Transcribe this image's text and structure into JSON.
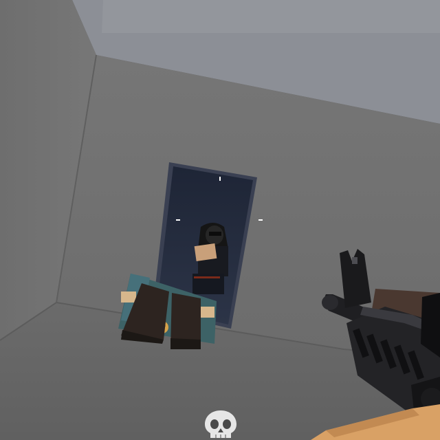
{
  "colors": {
    "wall": "#6f6f6f",
    "wall_dark": "#5b5b5b",
    "ceiling": "#8a8c92",
    "floor": "#6a6a6a",
    "doorway": "#22293a",
    "gun_dark": "#1d1d1f",
    "gun_tan": "#d9a165",
    "crosshair": "#ffffff"
  },
  "icons": {
    "kill": "skull-icon",
    "aim": "crosshair-icon"
  }
}
